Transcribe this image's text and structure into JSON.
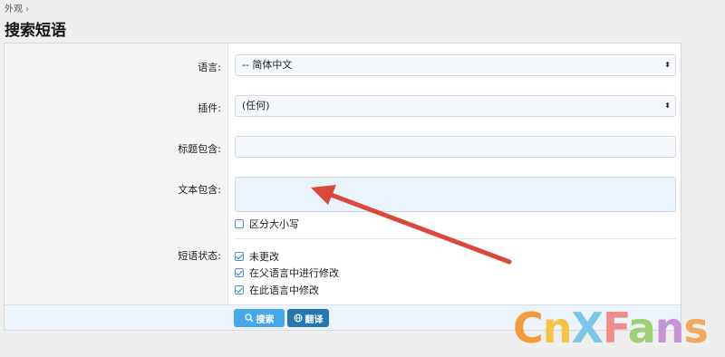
{
  "breadcrumb": {
    "item": "外观",
    "separator": "›"
  },
  "page_title": "搜索短语",
  "form": {
    "language": {
      "label": "语言:",
      "value": "-- 简体中文"
    },
    "addon": {
      "label": "插件:",
      "value": "(任何)"
    },
    "title_contains": {
      "label": "标题包含:",
      "value": ""
    },
    "text_contains": {
      "label": "文本包含:",
      "value": ""
    },
    "case_sensitive": {
      "label": "区分大小写",
      "checked": false
    },
    "phrase_state": {
      "label": "短语状态:",
      "options": [
        {
          "label": "未更改",
          "checked": true
        },
        {
          "label": "在父语言中进行修改",
          "checked": true
        },
        {
          "label": "在此语言中修改",
          "checked": true
        }
      ]
    }
  },
  "buttons": {
    "search": "搜索",
    "translate": "翻译"
  },
  "watermark": {
    "part1": "C",
    "part2": "n",
    "part3": "X",
    "part4": "F",
    "part5": "a",
    "part6": "n",
    "part7": "s"
  },
  "colors": {
    "accent": "#47a7eb",
    "primary": "#2577b1",
    "annotation_arrow": "#d9483b"
  }
}
